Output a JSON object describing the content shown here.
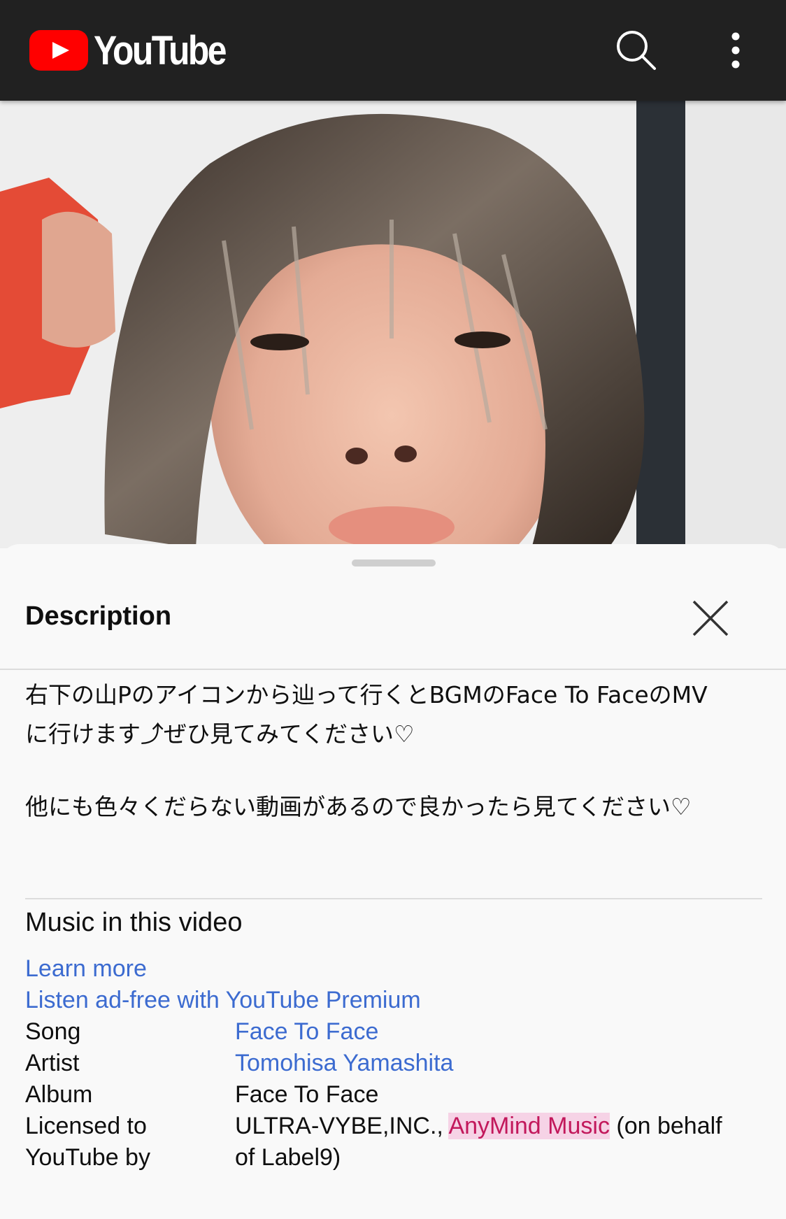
{
  "header": {
    "app_name": "YouTube",
    "brand_color": "#ff0000",
    "background": "#212121",
    "icons": [
      "search-icon",
      "more-vert-icon"
    ]
  },
  "video": {
    "description": "video thumbnail"
  },
  "sheet": {
    "title": "Description",
    "close_icon": "close-icon",
    "description_lines": [
      "右下の山Pのアイコンから辿って行くとBGMのFace To FaceのMV",
      "に行けます⤴︎ぜひ見てみてください♡",
      "他にも色々くだらない動画があるので良かったら見てください♡"
    ]
  },
  "music": {
    "heading": "Music in this video",
    "learn_more": "Learn more",
    "premium_link": "Listen ad-free with YouTube Premium",
    "song_label": "Song",
    "song_value": "Face To Face",
    "artist_label": "Artist",
    "artist_value": "Tomohisa Yamashita",
    "album_label": "Album",
    "album_value": "Face To Face",
    "licensed_label_1": "Licensed to",
    "licensed_label_2": "YouTube by",
    "licensed_value_1a": "ULTRA-VYBE,INC., ",
    "licensed_value_1b": "AnyMind Music",
    "licensed_value_1c": " (on behalf",
    "licensed_value_2": "of Label9)",
    "link_color": "#3c6bd0"
  }
}
